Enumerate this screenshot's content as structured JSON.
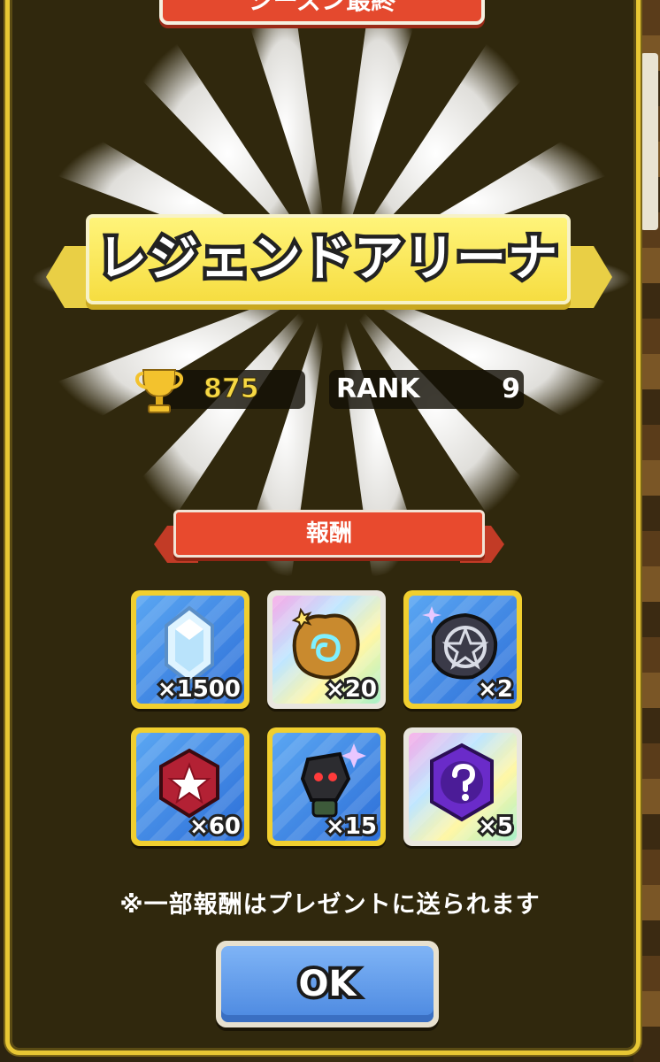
{
  "top_banner": {
    "label": "シーズン最終"
  },
  "title": "レジェンドアリーナ",
  "stats": {
    "trophy_score": "875",
    "rank_label": "RANK",
    "rank_value": "9"
  },
  "rewards_header": "報酬",
  "rewards": [
    {
      "name": "crystal",
      "qty": "×1500",
      "frame": "gold",
      "bg": "blue"
    },
    {
      "name": "gold-rune-stone",
      "qty": "×20",
      "frame": "silver",
      "bg": "rainbow"
    },
    {
      "name": "pentagram-stone",
      "qty": "×2",
      "frame": "gold",
      "bg": "blue"
    },
    {
      "name": "red-gem",
      "qty": "×60",
      "frame": "gold",
      "bg": "blue"
    },
    {
      "name": "dark-creature",
      "qty": "×15",
      "frame": "gold",
      "bg": "blue"
    },
    {
      "name": "mystery-item",
      "qty": "×5",
      "frame": "silver",
      "bg": "rainbow"
    }
  ],
  "note": "※一部報酬はプレゼントに送られます",
  "ok_button": "OK"
}
